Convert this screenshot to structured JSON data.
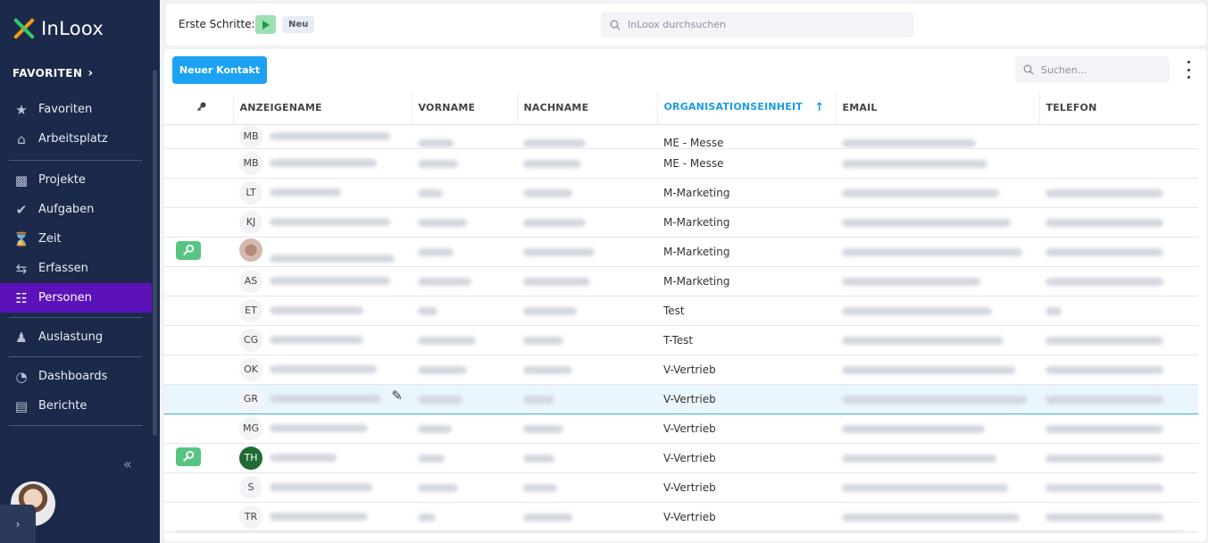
{
  "app": {
    "name": "InLoox"
  },
  "sidebar": {
    "favorites_header": "FAVORITEN",
    "groups": [
      [
        {
          "label": "Favoriten",
          "icon": "star-icon"
        },
        {
          "label": "Arbeitsplatz",
          "icon": "home-icon"
        }
      ],
      [
        {
          "label": "Projekte",
          "icon": "briefcase-icon"
        },
        {
          "label": "Aufgaben",
          "icon": "check-circle-icon"
        },
        {
          "label": "Zeit",
          "icon": "hourglass-icon"
        },
        {
          "label": "Erfassen",
          "icon": "sliders-icon"
        },
        {
          "label": "Personen",
          "icon": "person-card-icon",
          "active": true
        }
      ],
      [
        {
          "label": "Auslastung",
          "icon": "person-load-icon"
        }
      ],
      [
        {
          "label": "Dashboards",
          "icon": "pie-chart-icon"
        },
        {
          "label": "Berichte",
          "icon": "report-icon"
        }
      ]
    ]
  },
  "topbar": {
    "first_steps_label": "Erste Schritte:",
    "new_badge": "Neu",
    "search_placeholder": "InLoox durchsuchen"
  },
  "toolbar": {
    "new_contact_label": "Neuer Kontakt",
    "search_placeholder": "Suchen..."
  },
  "table": {
    "columns": [
      "",
      "ANZEIGENAME",
      "VORNAME",
      "NACHNAME",
      "ORGANISATIONSEINHEIT",
      "EMAIL",
      "TELEFON"
    ],
    "sorted_column": "ORGANISATIONSEINHEIT",
    "rows": [
      {
        "initials": "MB",
        "org": "ME - Messe",
        "key": false,
        "phone": false
      },
      {
        "initials": "MB",
        "org": "ME - Messe",
        "key": false,
        "phone": false
      },
      {
        "initials": "LT",
        "org": "M-Marketing",
        "key": false,
        "phone": true
      },
      {
        "initials": "KJ",
        "org": "M-Marketing",
        "key": false,
        "phone": true
      },
      {
        "initials": "",
        "org": "M-Marketing",
        "key": true,
        "phone": true,
        "photo": true
      },
      {
        "initials": "AS",
        "org": "M-Marketing",
        "key": false,
        "phone": true
      },
      {
        "initials": "ET",
        "org": "Test",
        "key": false,
        "phone": true
      },
      {
        "initials": "CG",
        "org": "T-Test",
        "key": false,
        "phone": true
      },
      {
        "initials": "OK",
        "org": "V-Vertrieb",
        "key": false,
        "phone": true
      },
      {
        "initials": "GR",
        "org": "V-Vertrieb",
        "key": false,
        "phone": true,
        "selected": true
      },
      {
        "initials": "MG",
        "org": "V-Vertrieb",
        "key": false,
        "phone": true
      },
      {
        "initials": "TH",
        "org": "V-Vertrieb",
        "key": true,
        "phone": true,
        "green": true
      },
      {
        "initials": "S",
        "org": "V-Vertrieb",
        "key": false,
        "phone": true
      },
      {
        "initials": "TR",
        "org": "V-Vertrieb",
        "key": false,
        "phone": true
      }
    ]
  },
  "colors": {
    "sidebar": "#1b2a4a",
    "active": "#5b12b8",
    "accent": "#1da1f2",
    "key_badge": "#58c484"
  }
}
